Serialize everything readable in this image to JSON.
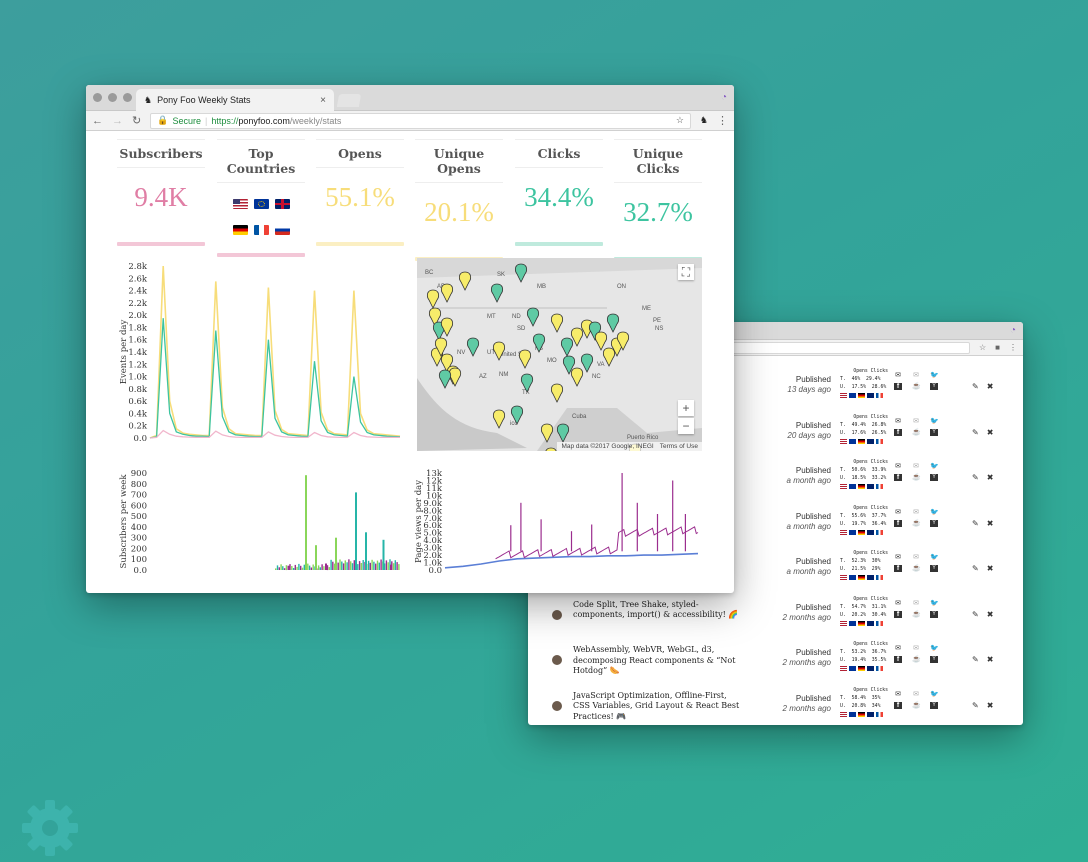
{
  "colors": {
    "background": "#33a39a",
    "pink": "#e07ea5",
    "yellow": "#f7dd7a",
    "green": "#3dc4a0",
    "purple": "#9b2d8e",
    "blue": "#5b7fd6"
  },
  "front": {
    "tab_title": "Pony Foo Weekly Stats",
    "tab_close": "×",
    "secure_label": "Secure",
    "url_scheme": "https://",
    "url_host": "ponyfoo.com",
    "url_path": "/weekly/stats",
    "stats": [
      {
        "label": "Subscribers",
        "value": "9.4K",
        "color": "#e07ea5"
      },
      {
        "label": "Top Countries",
        "value": "",
        "color": "#e07ea5"
      },
      {
        "label": "Opens",
        "value": "55.1%",
        "color": "#f7dd7a"
      },
      {
        "label": "Unique Opens",
        "value": "20.1%",
        "color": "#f7dd7a"
      },
      {
        "label": "Clicks",
        "value": "34.4%",
        "color": "#3dc4a0"
      },
      {
        "label": "Unique Clicks",
        "value": "32.7%",
        "color": "#3dc4a0"
      }
    ],
    "top_countries": [
      "us-flag",
      "eu-flag",
      "uk-flag",
      "de-flag",
      "fr-flag",
      "ru-flag"
    ],
    "map": {
      "credit": "Map data ©2017 Google, INEGI",
      "terms": "Terms of Use",
      "zoom_in": "+",
      "zoom_out": "−",
      "labels": [
        "BC",
        "SK",
        "MB",
        "AB",
        "MT",
        "ND",
        "SD",
        "NV",
        "UT",
        "United St",
        "KS",
        "AZ",
        "NM",
        "TX",
        "MO",
        "VA",
        "NC",
        "ME",
        "NS",
        "PE",
        "Cuba",
        "Puerto Rico",
        "ico",
        "ON"
      ]
    }
  },
  "chart_data": [
    {
      "type": "line",
      "title": "",
      "ylabel": "Events per day",
      "yticks": [
        "0.0",
        "0.2k",
        "0.4k",
        "0.6k",
        "0.8k",
        "1.0k",
        "1.2k",
        "1.4k",
        "1.6k",
        "1.8k",
        "2.0k",
        "2.2k",
        "2.4k",
        "2.6k",
        "2.8k"
      ],
      "ylim": [
        0,
        2800
      ],
      "series": [
        {
          "color": "#f7dd7a",
          "values": [
            0,
            40,
            2800,
            600,
            150,
            80,
            60,
            50,
            40,
            40,
            2550,
            500,
            150,
            70,
            60,
            50,
            40,
            40,
            2450,
            450,
            140,
            70,
            60,
            50,
            40,
            2400,
            420,
            130,
            70,
            60,
            50,
            2400,
            400,
            130,
            70,
            60,
            50,
            40,
            30
          ]
        },
        {
          "color": "#3dc4a0",
          "values": [
            0,
            20,
            1950,
            400,
            100,
            60,
            40,
            30,
            30,
            25,
            1750,
            350,
            100,
            50,
            40,
            30,
            25,
            25,
            1600,
            320,
            100,
            50,
            40,
            30,
            25,
            1250,
            280,
            90,
            50,
            40,
            30,
            1000,
            260,
            90,
            50,
            40,
            30,
            25,
            20
          ]
        },
        {
          "color": "#f1b6cc",
          "values": [
            0,
            10,
            120,
            60,
            30,
            20,
            15,
            10,
            10,
            10,
            110,
            50,
            25,
            15,
            10,
            10,
            10,
            10,
            100,
            45,
            25,
            15,
            10,
            10,
            10,
            90,
            40,
            20,
            15,
            10,
            10,
            90,
            40,
            20,
            15,
            10,
            10,
            10,
            10
          ]
        }
      ]
    },
    {
      "type": "bar",
      "title": "",
      "ylabel": "Subscribers per week",
      "yticks": [
        "0.0",
        "100",
        "200",
        "300",
        "400",
        "500",
        "600",
        "700",
        "800",
        "900"
      ],
      "ylim": [
        0,
        900
      ],
      "series": [
        {
          "color": "#8ad65a",
          "peaks": [
            {
              "x": 0.62,
              "value": 880
            },
            {
              "x": 0.66,
              "value": 230
            },
            {
              "x": 0.74,
              "value": 300
            }
          ]
        },
        {
          "color": "#26b5a8",
          "peaks": [
            {
              "x": 0.82,
              "value": 720
            },
            {
              "x": 0.86,
              "value": 350
            },
            {
              "x": 0.93,
              "value": 280
            }
          ]
        },
        {
          "color": "#9b2d8e",
          "peaks": [
            {
              "x": 0.55,
              "value": 40
            },
            {
              "x": 0.7,
              "value": 60
            },
            {
              "x": 0.96,
              "value": 50
            }
          ]
        }
      ]
    },
    {
      "type": "line",
      "title": "",
      "ylabel": "Page views per day",
      "yticks": [
        "0.0",
        "1.0k",
        "2.0k",
        "3.0k",
        "4.0k",
        "5.0k",
        "6.0k",
        "7.0k",
        "8.0k",
        "9.0k",
        "10k",
        "11k",
        "12k",
        "13k"
      ],
      "ylim": [
        0,
        13000
      ],
      "series": [
        {
          "color": "#5b7fd6",
          "values": [
            300,
            500,
            800,
            1200,
            1500,
            1600,
            1700,
            1800,
            1800,
            1900,
            1900,
            2000,
            2000,
            2100,
            2200
          ]
        },
        {
          "color": "#9b2d8e",
          "spikes": [
            {
              "x": 0.26,
              "value": 6000
            },
            {
              "x": 0.3,
              "value": 9000
            },
            {
              "x": 0.38,
              "value": 6800
            },
            {
              "x": 0.5,
              "value": 5200
            },
            {
              "x": 0.58,
              "value": 6100
            },
            {
              "x": 0.7,
              "value": 13000
            },
            {
              "x": 0.76,
              "value": 9000
            },
            {
              "x": 0.84,
              "value": 7500
            },
            {
              "x": 0.9,
              "value": 12000
            },
            {
              "x": 0.95,
              "value": 7500
            }
          ]
        }
      ]
    }
  ],
  "back": {
    "rows": [
      {
        "title": "",
        "published": "Published",
        "when": "13 days ago",
        "col_opens": "Opens",
        "col_clicks": "Clicks",
        "t_label": "T.",
        "u_label": "U.",
        "t_open": "46%",
        "t_click": "29.4%",
        "u_open": "17.5%",
        "u_click": "28.6%"
      },
      {
        "title": "",
        "published": "Published",
        "when": "20 days ago",
        "col_opens": "Opens",
        "col_clicks": "Clicks",
        "t_label": "T.",
        "u_label": "U.",
        "t_open": "49.4%",
        "t_click": "26.8%",
        "u_open": "17.6%",
        "u_click": "26.5%"
      },
      {
        "title": "",
        "published": "Published",
        "when": "a month ago",
        "col_opens": "Opens",
        "col_clicks": "Clicks",
        "t_label": "T.",
        "u_label": "U.",
        "t_open": "50.6%",
        "t_click": "33.9%",
        "u_open": "18.5%",
        "u_click": "33.2%"
      },
      {
        "title": "",
        "published": "Published",
        "when": "a month ago",
        "col_opens": "Opens",
        "col_clicks": "Clicks",
        "t_label": "T.",
        "u_label": "U.",
        "t_open": "55.6%",
        "t_click": "37.7%",
        "u_open": "19.7%",
        "u_click": "36.4%"
      },
      {
        "title": "",
        "published": "Published",
        "when": "a month ago",
        "col_opens": "Opens",
        "col_clicks": "Clicks",
        "t_label": "T.",
        "u_label": "U.",
        "t_open": "52.3%",
        "t_click": "30%",
        "u_open": "21.5%",
        "u_click": "29%"
      },
      {
        "title": "Code Split, Tree Shake, styled-components, import() & accessibility! 🌈",
        "published": "Published",
        "when": "2 months ago",
        "col_opens": "Opens",
        "col_clicks": "Clicks",
        "t_label": "T.",
        "u_label": "U.",
        "t_open": "54.7%",
        "t_click": "31.1%",
        "u_open": "20.2%",
        "u_click": "30.4%"
      },
      {
        "title": "WebAssembly, WebVR, WebGL, d3, decomposing React components & “Not Hotdog” 🌭",
        "published": "Published",
        "when": "2 months ago",
        "col_opens": "Opens",
        "col_clicks": "Clicks",
        "t_label": "T.",
        "u_label": "U.",
        "t_open": "53.2%",
        "t_click": "36.7%",
        "u_open": "19.4%",
        "u_click": "35.5%"
      },
      {
        "title": "JavaScript Optimization, Offline-First, CSS Variables, Grid Layout & React Best Practices! 🎮",
        "published": "Published",
        "when": "2 months ago",
        "col_opens": "Opens",
        "col_clicks": "Clicks",
        "t_label": "T.",
        "u_label": "U.",
        "t_open": "58.4%",
        "t_click": "35%",
        "u_open": "20.8%",
        "u_click": "34%"
      }
    ]
  }
}
